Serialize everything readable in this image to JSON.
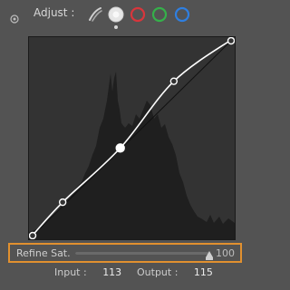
{
  "header": {
    "icons": {
      "settings": "settings-circle-icon",
      "brushes": "brush-strokes-icon"
    },
    "adjust_label": "Adjust :",
    "channels": [
      {
        "name": "luminance",
        "color": "#e6e6e6",
        "selected": true
      },
      {
        "name": "red",
        "color": "#d8363c",
        "selected": false
      },
      {
        "name": "green",
        "color": "#35b04a",
        "selected": false
      },
      {
        "name": "blue",
        "color": "#2f7fe0",
        "selected": false
      }
    ]
  },
  "curve": {
    "input_range": [
      0,
      255
    ],
    "output_range": [
      0,
      255
    ],
    "control_points": [
      {
        "input": 0,
        "output": 0
      },
      {
        "input": 41,
        "output": 46
      },
      {
        "input": 113,
        "output": 115
      },
      {
        "input": 180,
        "output": 200
      },
      {
        "input": 255,
        "output": 255
      }
    ],
    "selected_point_index": 2
  },
  "refine": {
    "label": "Refine Sat.",
    "value": "100",
    "level": 1.0
  },
  "readout": {
    "input_label": "Input :",
    "input_value": "113",
    "output_label": "Output :",
    "output_value": "115"
  },
  "colors": {
    "accent": "#e1902f",
    "panel_bg": "#535353",
    "graph_bg": "#333333",
    "histogram": "#1f1f1f",
    "curve": "#ffffff",
    "diagonal": "#111111"
  }
}
